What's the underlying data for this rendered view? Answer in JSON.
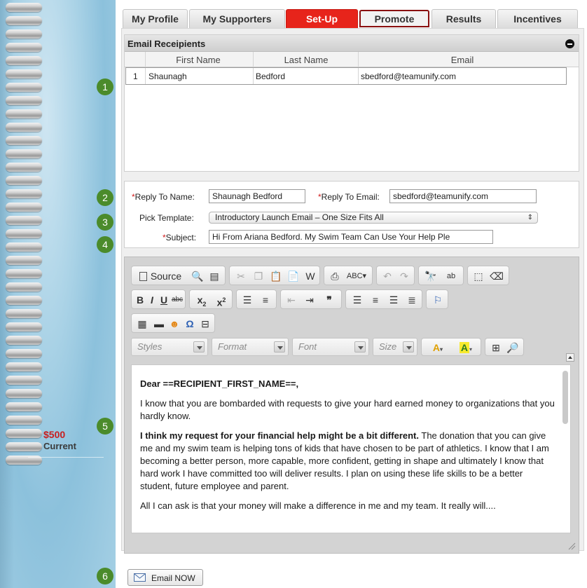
{
  "colors": {
    "accent_red": "#e7241b",
    "marker_green": "#4b8b2b",
    "amount_red": "#c81e1e"
  },
  "sidebar": {
    "amount": "$500",
    "amount_label": "Current"
  },
  "markers": [
    "1",
    "2",
    "3",
    "4",
    "5",
    "6"
  ],
  "tabs": [
    {
      "label": "My Profile"
    },
    {
      "label": "My Supporters"
    },
    {
      "label": "Set-Up",
      "state": "active"
    },
    {
      "label": "Promote",
      "state": "outlined"
    },
    {
      "label": "Results"
    },
    {
      "label": "Incentives"
    }
  ],
  "recipients": {
    "title": "Email Receipients",
    "columns": [
      "First Name",
      "Last Name",
      "Email"
    ],
    "rows": [
      {
        "index": "1",
        "first": "Shaunagh",
        "last": "Bedford",
        "email": "sbedford@teamunify.com"
      }
    ]
  },
  "form": {
    "reply_to_name_label": "Reply To Name:",
    "reply_to_name_value": "Shaunagh Bedford",
    "reply_to_email_label": "Reply To Email:",
    "reply_to_email_value": "sbedford@teamunify.com",
    "template_label": "Pick Template:",
    "template_value": "Introductory Launch Email – One Size Fits All",
    "subject_label": "Subject:",
    "subject_value": "Hi From Ariana Bedford. My Swim Team Can Use Your Help Ple"
  },
  "editor": {
    "source_label": "Source",
    "combos": {
      "styles": "Styles",
      "format": "Format",
      "font": "Font",
      "size": "Size"
    },
    "toolbar_icons": [
      "source-icon",
      "preview-icon",
      "templates-icon",
      "cut-icon",
      "copy-icon",
      "paste-icon",
      "paste-text-icon",
      "paste-word-icon",
      "print-icon",
      "spellcheck-icon",
      "undo-icon",
      "redo-icon",
      "find-icon",
      "replace-icon",
      "select-all-icon",
      "remove-format-icon",
      "bold-icon",
      "italic-icon",
      "underline-icon",
      "strike-icon",
      "subscript-icon",
      "superscript-icon",
      "numbered-list-icon",
      "bullet-list-icon",
      "outdent-icon",
      "indent-icon",
      "blockquote-icon",
      "align-left-icon",
      "align-center-icon",
      "align-right-icon",
      "justify-icon",
      "flag-icon",
      "table-icon",
      "horizontal-rule-icon",
      "smiley-icon",
      "special-char-icon",
      "page-break-icon",
      "text-color-icon",
      "bg-color-icon",
      "maximize-icon",
      "show-blocks-icon"
    ],
    "body": {
      "greeting": "Dear ==RECIPIENT_FIRST_NAME==,",
      "p1": "I know that you are bombarded with requests to give your hard earned money to organizations that you hardly know.",
      "p2_bold": "I think my request for your financial help might be a bit different.",
      "p2_rest": " The donation that you can give me and my swim team is helping tons of kids that have chosen to be part of athletics. I know that I am becoming a better person, more capable, more confident, getting in shape and ultimately I know that hard work I have committed too will deliver results. I plan on using these life skills to be a better student, future employee and parent.",
      "p3": "All I can ask is that your money will make a difference in me and my team. It really will...."
    }
  },
  "actions": {
    "email_now": "Email NOW"
  }
}
